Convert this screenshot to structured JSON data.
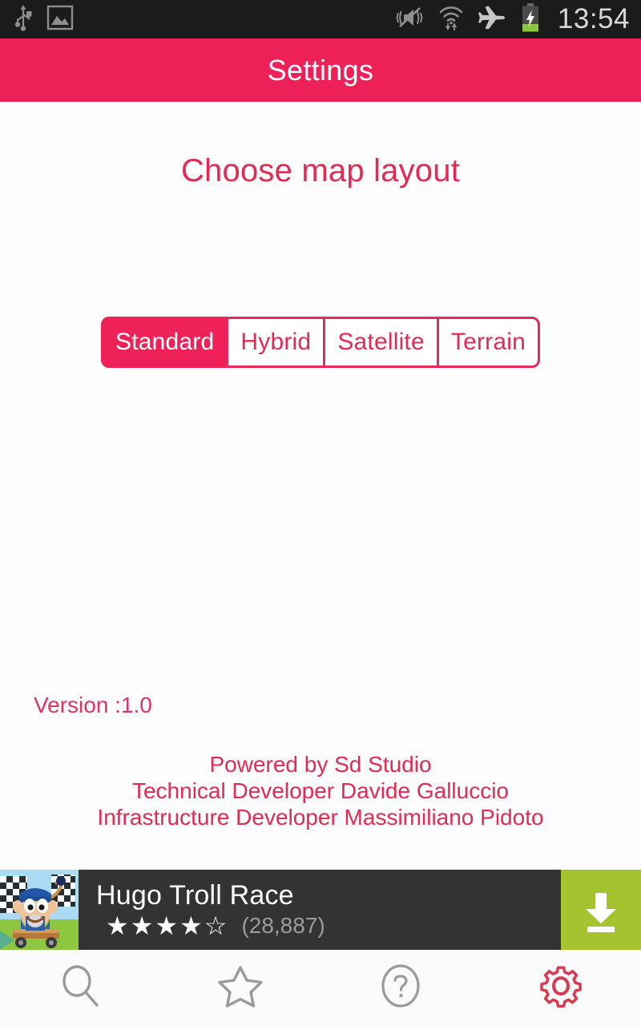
{
  "status_bar": {
    "icons": [
      "usb-icon",
      "screenshot-image-icon",
      "vibrate-mute-icon",
      "wifi-data-icon",
      "airplane-mode-icon",
      "battery-charging-icon"
    ],
    "clock": "13:54",
    "background_color": "#1b1b1b",
    "text_color": "#d8d8d8"
  },
  "action_bar": {
    "title": "Settings",
    "background_color": "#ED2158",
    "title_color": "#ffffff"
  },
  "content": {
    "heading": "Choose map layout",
    "heading_color": "#E12A54",
    "accent_color": "#E42B5C"
  },
  "map_layout": {
    "selected": "Standard",
    "options": [
      {
        "label": "Standard",
        "selected": true
      },
      {
        "label": "Hybrid",
        "selected": false
      },
      {
        "label": "Satellite",
        "selected": false
      },
      {
        "label": "Terrain",
        "selected": false
      }
    ]
  },
  "footer": {
    "version": "Version :1.0",
    "credits": [
      "Powered by Sd Studio",
      "Technical Developer Davide Galluccio",
      "Infrastructure Developer Massimiliano Pidoto"
    ]
  },
  "ad": {
    "app_name": "Hugo Troll Race",
    "stars": "★★★★☆",
    "rating_value": 4,
    "rating_max": 5,
    "review_count": "(28,887)",
    "install_icon": "download-arrow-icon",
    "install_button_color": "#A4C32F",
    "background_color": "#333333"
  },
  "bottom_nav": {
    "items": [
      {
        "name": "search",
        "icon": "search-icon",
        "active": false
      },
      {
        "name": "favorites",
        "icon": "star-icon",
        "active": false
      },
      {
        "name": "help",
        "icon": "question-mark-circle-icon",
        "active": false
      },
      {
        "name": "settings",
        "icon": "gear-icon",
        "active": true
      }
    ],
    "inactive_color": "#9a9a9a",
    "active_color": "#D93A52"
  }
}
